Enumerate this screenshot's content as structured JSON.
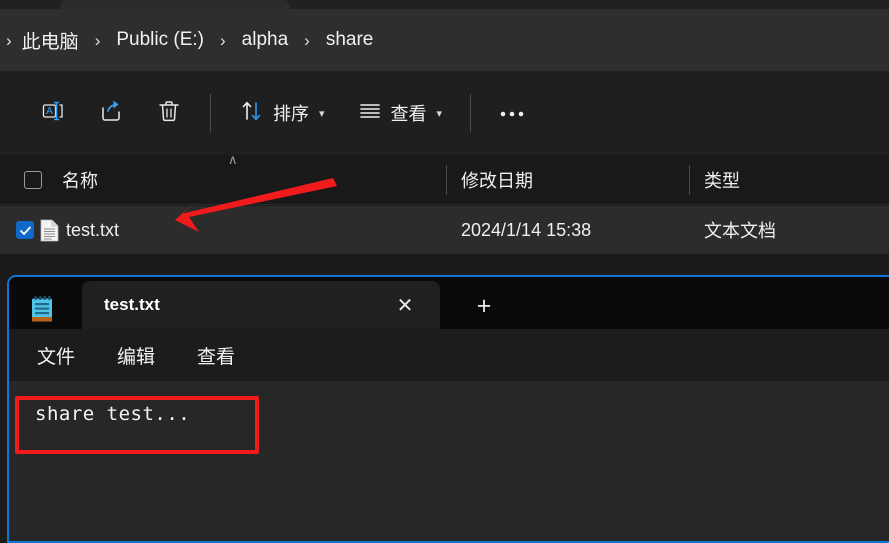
{
  "explorer": {
    "breadcrumb": {
      "separator": "›",
      "items": [
        "此电脑",
        "Public (E:)",
        "alpha",
        "share"
      ]
    },
    "toolbar": {
      "buttons": [
        {
          "name": "rename-button",
          "icon": "rename-icon",
          "label": ""
        },
        {
          "name": "share-button",
          "icon": "share-icon",
          "label": ""
        },
        {
          "name": "delete-button",
          "icon": "trash-icon",
          "label": ""
        },
        {
          "name": "sort-button",
          "icon": "sort-icon",
          "label": "排序"
        },
        {
          "name": "view-button",
          "icon": "view-icon",
          "label": "查看"
        },
        {
          "name": "more-button",
          "icon": "ellipsis-icon",
          "label": ""
        }
      ],
      "sort_label": "排序",
      "view_label": "查看",
      "more_label": "•••"
    },
    "columns": {
      "name": "名称",
      "date_modified": "修改日期",
      "type": "类型",
      "sort_indicator": "∧"
    },
    "rows": [
      {
        "selected": true,
        "icon": "text-file-icon",
        "name": "test.txt",
        "date_modified": "2024/1/14 15:38",
        "type": "文本文档"
      }
    ]
  },
  "notepad": {
    "app_icon": "notepad-icon",
    "tab": {
      "title": "test.txt",
      "close_label": "✕"
    },
    "new_tab_label": "+",
    "menu": [
      "文件",
      "编辑",
      "查看"
    ],
    "content": "share test..."
  },
  "annotations": {
    "arrow": {
      "name": "red-arrow-annotation",
      "color": "#f21b1b"
    },
    "box": {
      "name": "red-box-annotation",
      "color": "#f21b1b"
    }
  },
  "colors": {
    "accent_blue": "#1168c9",
    "window_border_blue": "#1076d1",
    "annotation_red": "#f21b1b"
  }
}
